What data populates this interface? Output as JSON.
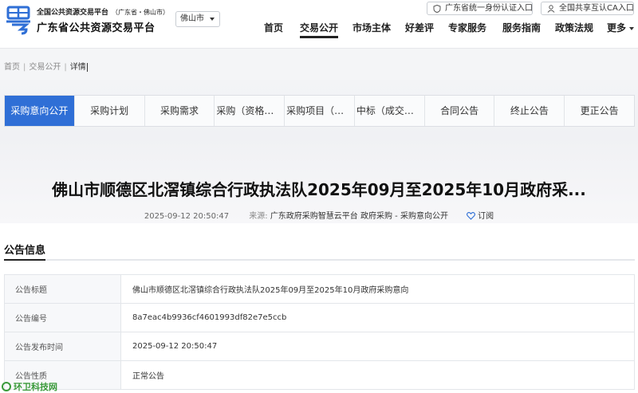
{
  "header": {
    "brand_top": "全国公共资源交易平台",
    "brand_top_sub": "（广东省・佛山市）",
    "brand_main": "广东省公共资源交易平台",
    "city_select": "佛山市",
    "auth_buttons": [
      "广东省统一身份认证入口",
      "全国共享互认CA入口"
    ],
    "nav": [
      "首页",
      "交易公开",
      "市场主体",
      "好差评",
      "专家服务",
      "服务指南",
      "政策法规",
      "更多"
    ],
    "accent_color": "#2f6fd6"
  },
  "breadcrumb": [
    "首页",
    "交易公开",
    "详情"
  ],
  "tabs": [
    "采购意向公开",
    "采购计划",
    "采购需求",
    "采购（资格预审）公告",
    "采购项目（公告）",
    "中标（成交）结果公告",
    "合同公告",
    "终止公告",
    "更正公告"
  ],
  "article": {
    "title": "佛山市顺德区北滘镇综合行政执法队2025年09月至2025年10月政府采...",
    "date": "2025-09-12 20:50:47",
    "source_label": "来源:",
    "source": "广东政府采购智慧云平台 政府采购 - 采购意向公开",
    "subscribe": "订阅"
  },
  "info": {
    "heading": "公告信息",
    "rows": [
      {
        "k": "公告标题",
        "v": "佛山市顺德区北滘镇综合行政执法队2025年09月至2025年10月政府采购意向"
      },
      {
        "k": "公告编号",
        "v": "8a7eac4b9936cf4601993df82e7e5ccb"
      },
      {
        "k": "公告发布时间",
        "v": "2025-09-12 20:50:47"
      },
      {
        "k": "公告性质",
        "v": "正常公告"
      }
    ]
  },
  "watermark": "环卫科技网"
}
